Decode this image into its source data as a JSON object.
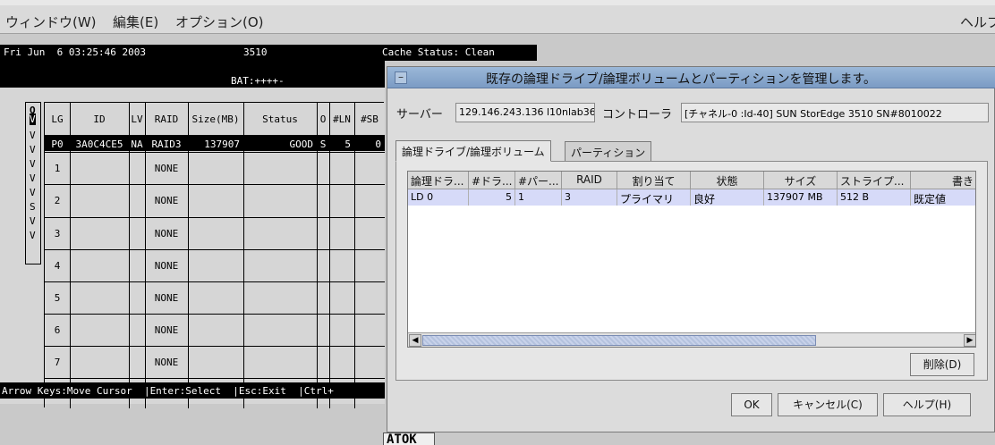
{
  "menubar": {
    "items": [
      "ウィンドウ(W)",
      "編集(E)",
      "オプション(O)"
    ],
    "help": "ヘルプ"
  },
  "terminal": {
    "date": "Fri Jun  6 03:25:46 2003",
    "model": "3510",
    "cache": "Cache Status: Clean",
    "bat": "BAT:++++-",
    "left_col": [
      "Q",
      "V",
      "V",
      "V",
      "V",
      "V",
      "V",
      "S",
      "V",
      "V"
    ],
    "headers": [
      "LG",
      "ID",
      "LV",
      "RAID",
      "Size(MB)",
      "Status",
      "O",
      "#LN",
      "#SB"
    ],
    "rows": [
      [
        "P0",
        "3A0C4CE5",
        "NA",
        "RAID3",
        "137907",
        "GOOD",
        "S",
        "5",
        "0"
      ],
      [
        "1",
        "",
        "",
        "NONE",
        "",
        "",
        "",
        "",
        ""
      ],
      [
        "2",
        "",
        "",
        "NONE",
        "",
        "",
        "",
        "",
        ""
      ],
      [
        "3",
        "",
        "",
        "NONE",
        "",
        "",
        "",
        "",
        ""
      ],
      [
        "4",
        "",
        "",
        "NONE",
        "",
        "",
        "",
        "",
        ""
      ],
      [
        "5",
        "",
        "",
        "NONE",
        "",
        "",
        "",
        "",
        ""
      ],
      [
        "6",
        "",
        "",
        "NONE",
        "",
        "",
        "",
        "",
        ""
      ],
      [
        "7",
        "",
        "",
        "NONE",
        "",
        "",
        "",
        "",
        ""
      ]
    ],
    "keys": "Arrow Keys:Move Cursor  |Enter:Select  |Esc:Exit  |Ctrl+"
  },
  "ime": "ATOK",
  "dialog": {
    "title": "既存の論理ドライブ/論理ボリュームとパーティションを管理します。",
    "server_label": "サーバー",
    "server_value": "129.146.243.136 l10nlab36",
    "controller_label": "コントローラ",
    "controller_value": "[チャネル-0 :Id-40] SUN StorEdge 3510 SN#8010022",
    "tabs": [
      "論理ドライブ/論理ボリューム",
      "パーティション"
    ],
    "columns": [
      "論理ドラ...",
      "#ドラ...",
      "#パー...",
      "RAID",
      "割り当て",
      "状態",
      "サイズ",
      "ストライプ...",
      "書き"
    ],
    "rows": [
      [
        "LD 0",
        "5",
        "1",
        "3",
        "プライマリ",
        "良好",
        "137907 MB",
        "512 B",
        "既定値"
      ]
    ],
    "delete_btn": "削除(D)",
    "ok_btn": "OK",
    "cancel_btn": "キャンセル(C)",
    "help_btn": "ヘルプ(H)"
  }
}
